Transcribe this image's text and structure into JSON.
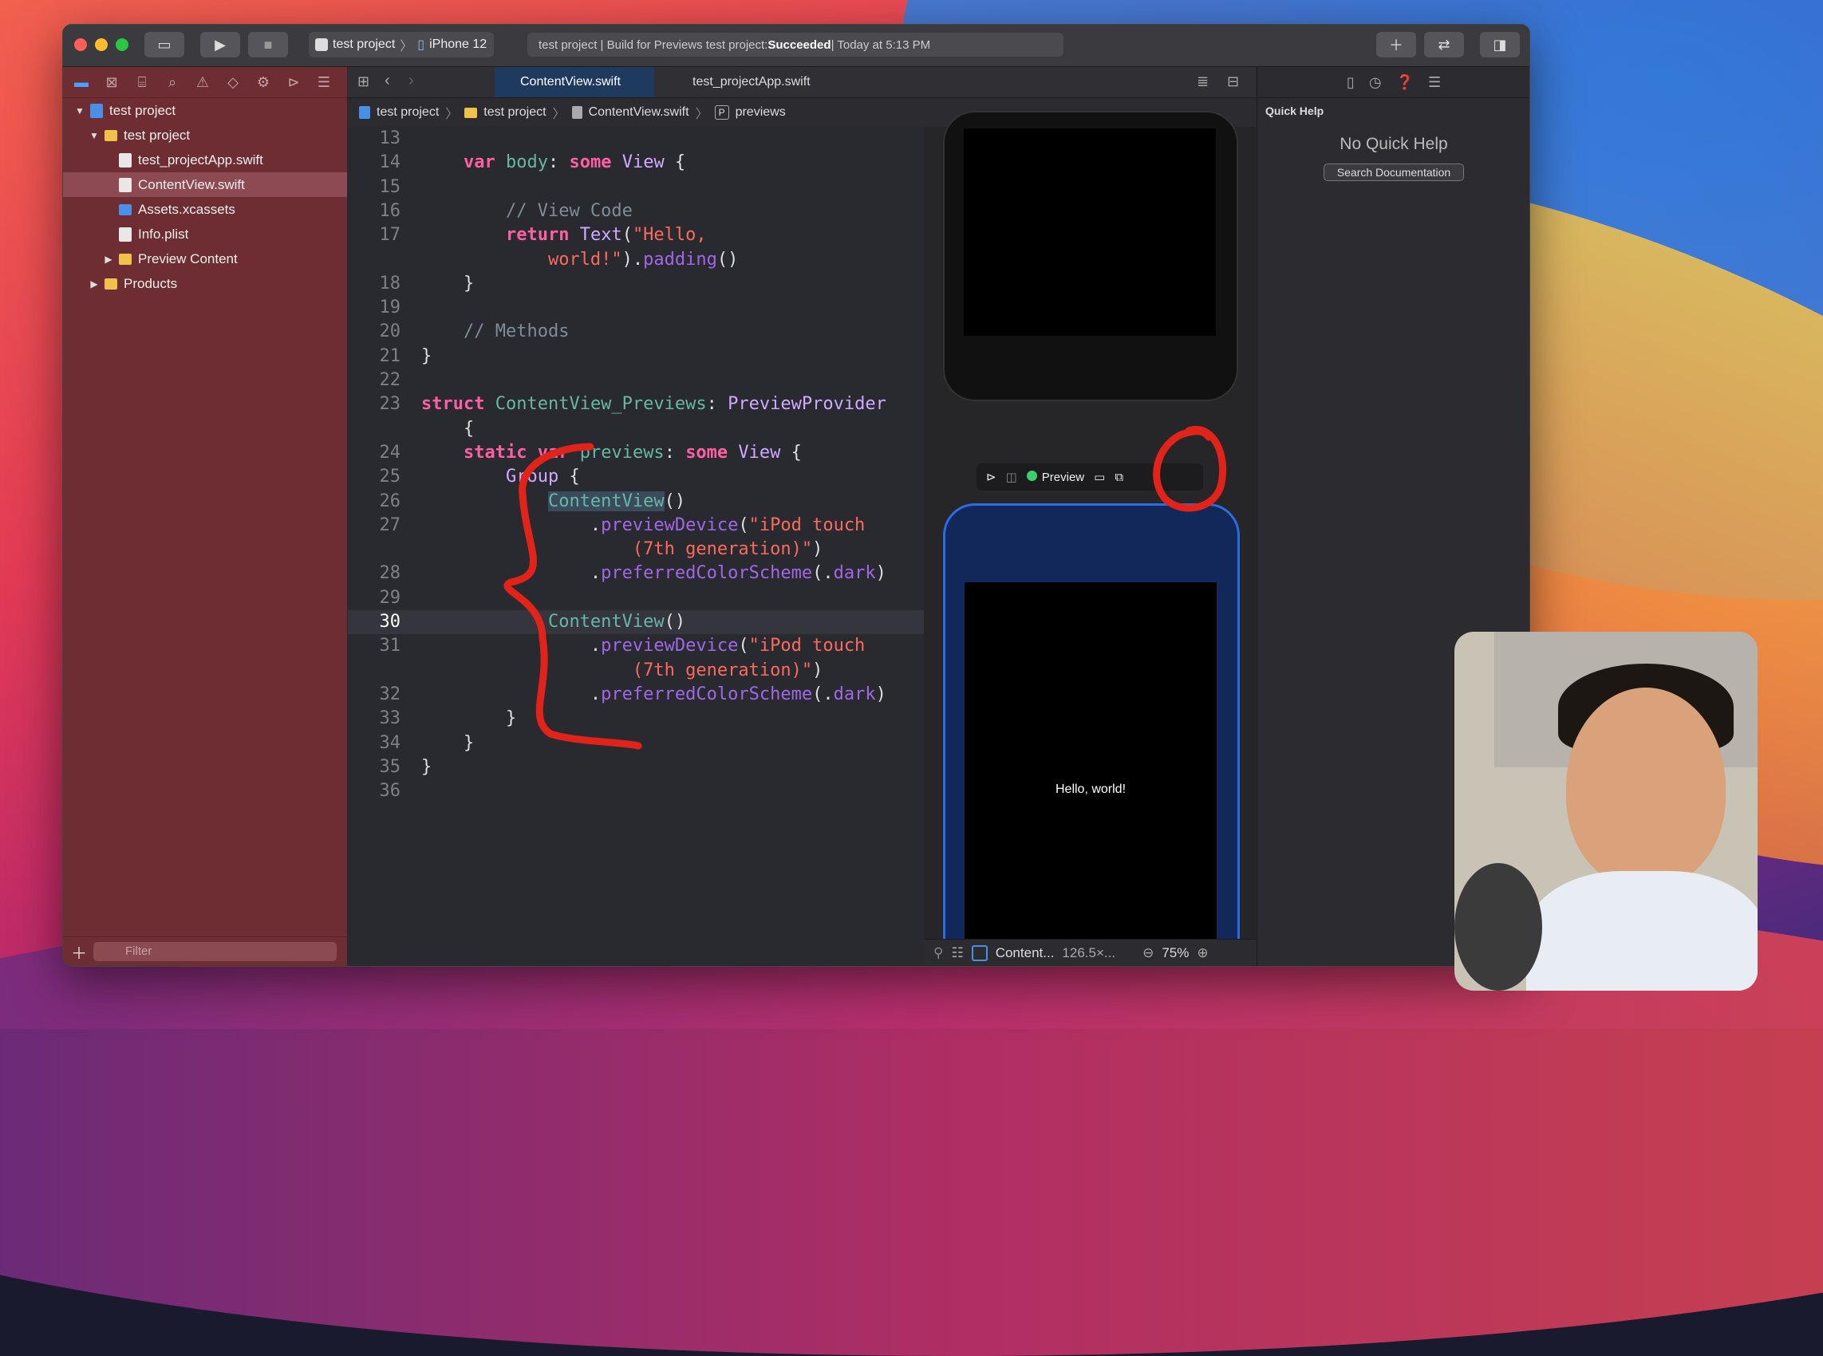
{
  "window": {
    "scheme": {
      "project": "test project",
      "device": "iPhone 12"
    },
    "activity": {
      "prefix": "test project | Build for Previews test project: ",
      "status": "Succeeded",
      "suffix": " | Today at 5:13 PM"
    }
  },
  "navigator": {
    "items": [
      {
        "label": "test project",
        "indent": 0,
        "disclosure": "open",
        "icon": "project"
      },
      {
        "label": "test project",
        "indent": 1,
        "disclosure": "open",
        "icon": "folder"
      },
      {
        "label": "test_projectApp.swift",
        "indent": 2,
        "disclosure": "",
        "icon": "swift"
      },
      {
        "label": "ContentView.swift",
        "indent": 2,
        "disclosure": "",
        "icon": "swift",
        "selected": true
      },
      {
        "label": "Assets.xcassets",
        "indent": 2,
        "disclosure": "",
        "icon": "assets"
      },
      {
        "label": "Info.plist",
        "indent": 2,
        "disclosure": "",
        "icon": "swift"
      },
      {
        "label": "Preview Content",
        "indent": 2,
        "disclosure": "closed",
        "icon": "folder"
      },
      {
        "label": "Products",
        "indent": 1,
        "disclosure": "closed",
        "icon": "folder"
      }
    ],
    "filter_placeholder": "Filter"
  },
  "tabs": [
    {
      "label": "ContentView.swift",
      "active": true
    },
    {
      "label": "test_projectApp.swift",
      "active": false
    }
  ],
  "breadcrumb": [
    "test project",
    "test project",
    "ContentView.swift",
    "previews"
  ],
  "breadcrumb_badge": "P",
  "code": {
    "current_line": "30",
    "lines": [
      {
        "n": "13",
        "html": ""
      },
      {
        "n": "14",
        "html": "    <span class='k'>var</span> <span class='p'>body</span>: <span class='k'>some</span> <span class='t'>View</span> {"
      },
      {
        "n": "15",
        "html": ""
      },
      {
        "n": "16",
        "html": "        <span class='c'>// View Code</span>"
      },
      {
        "n": "17",
        "html": "        <span class='k'>return</span> <span class='t'>Text</span>(<span class='s'>\"Hello,</span>"
      },
      {
        "n": "",
        "html": "            <span class='s'>world!\"</span>).<span class='f'>padding</span>()"
      },
      {
        "n": "18",
        "html": "    }"
      },
      {
        "n": "19",
        "html": ""
      },
      {
        "n": "20",
        "html": "    <span class='c'>// Methods</span>"
      },
      {
        "n": "21",
        "html": "}"
      },
      {
        "n": "22",
        "html": ""
      },
      {
        "n": "23",
        "html": "<span class='k'>struct</span> <span class='p'>ContentView_Previews</span>: <span class='t'>PreviewProvider</span>"
      },
      {
        "n": "",
        "html": "    {"
      },
      {
        "n": "24",
        "html": "    <span class='k'>static</span> <span class='k'>var</span> <span class='p'>previews</span>: <span class='k'>some</span> <span class='t'>View</span> {"
      },
      {
        "n": "25",
        "html": "        <span class='t'>Group</span> {"
      },
      {
        "n": "26",
        "html": "            <span class='m hl'>ContentView</span>()"
      },
      {
        "n": "27",
        "html": "                .<span class='f'>previewDevice</span>(<span class='s'>\"iPod touch</span>"
      },
      {
        "n": "",
        "html": "                    <span class='s'>(7th generation)\"</span>)"
      },
      {
        "n": "28",
        "html": "                .<span class='f'>preferredColorScheme</span>(.<span class='f'>dark</span>)"
      },
      {
        "n": "29",
        "html": ""
      },
      {
        "n": "30",
        "html": "            <span class='m'>ContentView</span>()"
      },
      {
        "n": "31",
        "html": "                .<span class='f'>previewDevice</span>(<span class='s'>\"iPod touch</span>"
      },
      {
        "n": "",
        "html": "                    <span class='s'>(7th generation)\"</span>)"
      },
      {
        "n": "32",
        "html": "                .<span class='f'>preferredColorScheme</span>(.<span class='f'>dark</span>)"
      },
      {
        "n": "33",
        "html": "        }"
      },
      {
        "n": "34",
        "html": "    }"
      },
      {
        "n": "35",
        "html": "}"
      },
      {
        "n": "36",
        "html": ""
      }
    ]
  },
  "canvas": {
    "preview_label": "Preview",
    "preview_text": "Hello, world!",
    "bottom_name": "Content...",
    "bottom_size": "126.5×...",
    "zoom": "75%"
  },
  "inspector": {
    "title": "Quick Help",
    "empty_message": "No Quick Help",
    "search_button": "Search Documentation"
  },
  "colors": {
    "navigator_bg": "#6d2d33",
    "accent": "#2b6de0",
    "annotation": "#e2231a"
  }
}
